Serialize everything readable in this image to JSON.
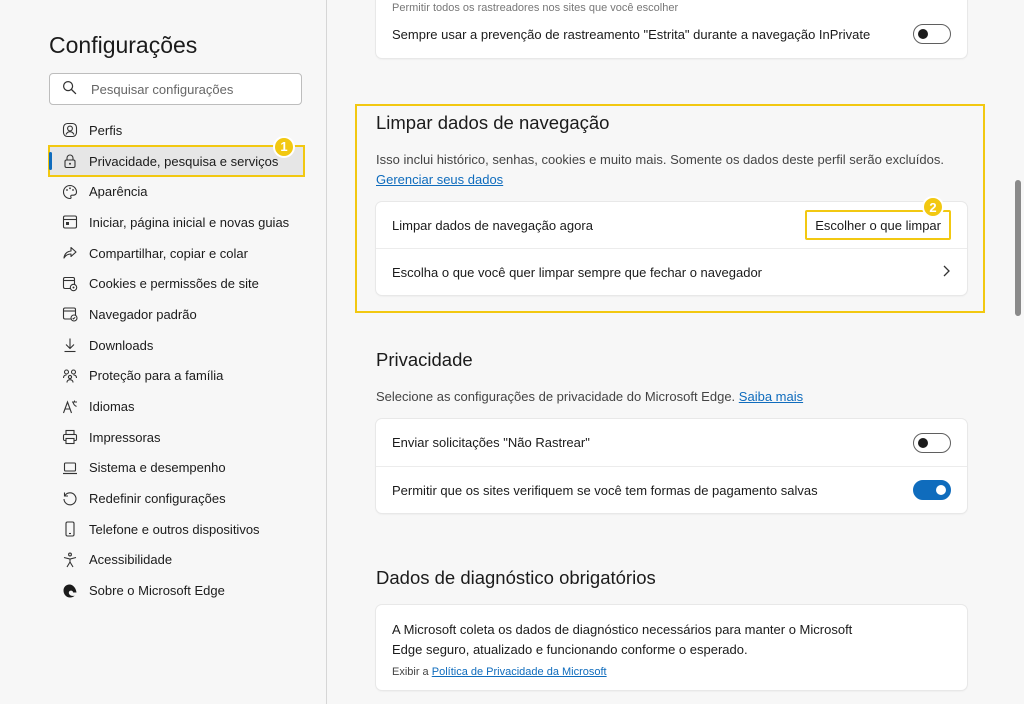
{
  "sidebar": {
    "title": "Configurações",
    "search_placeholder": "Pesquisar configurações",
    "items": [
      {
        "label": "Perfis",
        "icon": "profile-icon"
      },
      {
        "label": "Privacidade, pesquisa e serviços",
        "icon": "lock-icon",
        "active": true
      },
      {
        "label": "Aparência",
        "icon": "palette-icon"
      },
      {
        "label": "Iniciar, página inicial e novas guias",
        "icon": "home-tabs-icon"
      },
      {
        "label": "Compartilhar, copiar e colar",
        "icon": "share-icon"
      },
      {
        "label": "Cookies e permissões de site",
        "icon": "cookies-icon"
      },
      {
        "label": "Navegador padrão",
        "icon": "default-browser-icon"
      },
      {
        "label": "Downloads",
        "icon": "download-icon"
      },
      {
        "label": "Proteção para a família",
        "icon": "family-icon"
      },
      {
        "label": "Idiomas",
        "icon": "language-icon"
      },
      {
        "label": "Impressoras",
        "icon": "printer-icon"
      },
      {
        "label": "Sistema e desempenho",
        "icon": "laptop-icon"
      },
      {
        "label": "Redefinir configurações",
        "icon": "reset-icon"
      },
      {
        "label": "Telefone e outros dispositivos",
        "icon": "phone-icon"
      },
      {
        "label": "Acessibilidade",
        "icon": "accessibility-icon"
      },
      {
        "label": "Sobre o Microsoft Edge",
        "icon": "edge-icon"
      }
    ],
    "badge_1": "1"
  },
  "tracking": {
    "partial_row": "Permitir todos os rastreadores nos sites que você escolher",
    "strict_inprivate": "Sempre usar a prevenção de rastreamento \"Estrita\" durante a navegação InPrivate",
    "strict_inprivate_on": false
  },
  "clear_data": {
    "title": "Limpar dados de navegação",
    "description": "Isso inclui histórico, senhas, cookies e muito mais. Somente os dados deste perfil serão excluídos.",
    "manage_link": "Gerenciar seus dados",
    "now_label": "Limpar dados de navegação agora",
    "choose_button": "Escolher o que limpar",
    "on_close_label": "Escolha o que você quer limpar sempre que fechar o navegador",
    "badge_2": "2"
  },
  "privacy": {
    "title": "Privacidade",
    "description": "Selecione as configurações de privacidade do Microsoft Edge.",
    "learn_more": "Saiba mais",
    "dnt_label": "Enviar solicitações \"Não Rastrear\"",
    "dnt_on": false,
    "payment_label": "Permitir que os sites verifiquem se você tem formas de pagamento salvas",
    "payment_on": true
  },
  "diagnostics": {
    "title": "Dados de diagnóstico obrigatórios",
    "text_line1": "A Microsoft coleta os dados de diagnóstico necessários para manter o Microsoft",
    "text_line2": "Edge seguro, atualizado e funcionando conforme o esperado.",
    "show_prefix": "Exibir a",
    "policy_link": "Política de Privacidade da Microsoft"
  },
  "colors": {
    "accent": "#0f6cbd",
    "highlight": "#f2c811"
  }
}
